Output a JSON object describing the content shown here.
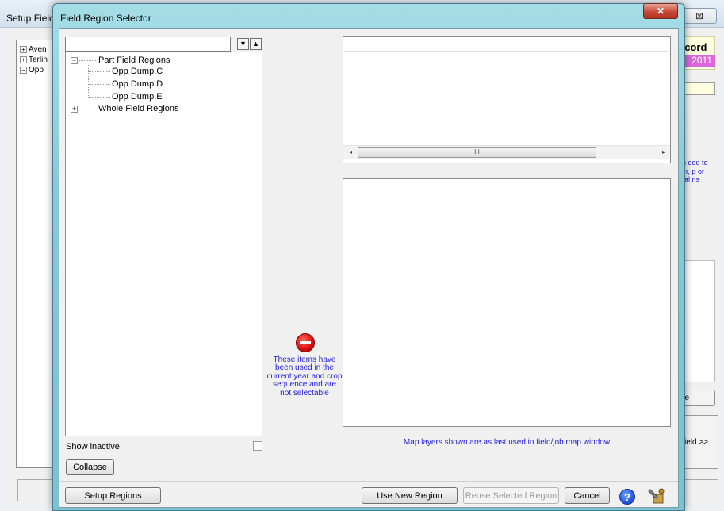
{
  "background_window": {
    "title": "Setup Field",
    "close_glyph": "⊠",
    "tree_items": [
      {
        "label": "Aven",
        "expander": "+"
      },
      {
        "label": "Terlin",
        "expander": "+"
      },
      {
        "label": "Opp",
        "expander": "−"
      }
    ],
    "record_label": "ecord",
    "year": "2011",
    "blue_text": "hen eed to eper, p or ernal ns",
    "button_e_label": "e",
    "button_field_label": "ield >>"
  },
  "dialog": {
    "title": "Field Region Selector",
    "close_glyph": "✕",
    "search": {
      "value": "",
      "placeholder": ""
    },
    "arrow_down_glyph": "▼",
    "arrow_up_glyph": "▲",
    "tree": {
      "part_field_regions": {
        "label": "Part Field Regions",
        "expander": "−",
        "children": [
          "Opp Dump.C",
          "Opp Dump.D",
          "Opp Dump.E"
        ]
      },
      "whole_field_regions": {
        "label": "Whole Field Regions",
        "expander": "+"
      }
    },
    "show_inactive_label": "Show inactive",
    "collapse_label": "Collapse",
    "warning_text": "These items have been used in the current year and crop sequence and are not selectable",
    "scrollbar": {
      "left_glyph": "◂",
      "right_glyph": "▸",
      "thumb_glyph": "III"
    },
    "map_note": "Map layers shown are as last used in field/job map window",
    "buttons": {
      "setup_regions": "Setup Regions",
      "use_new_region": "Use New Region",
      "reuse_selected_region": "Reuse Selected Region",
      "cancel": "Cancel",
      "help_glyph": "?"
    }
  },
  "colors": {
    "accent_blue_text": "#1f1fdf",
    "dialog_frame": "#86c8d6",
    "close_red": "#c9473a",
    "warning_red": "#d90d0d",
    "year_magenta": "#dd66dd"
  }
}
